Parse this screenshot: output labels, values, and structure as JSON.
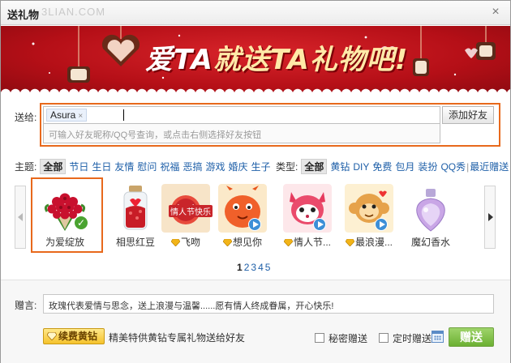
{
  "window": {
    "title": "送礼物",
    "watermark": "3LIAN.COM",
    "close_glyph": "×"
  },
  "banner": {
    "slogan_part1": "爱TA",
    "slogan_part2": "就送TA礼物吧!"
  },
  "recipient": {
    "label": "送给:",
    "tag_name": "Asura",
    "tag_remove": "×",
    "hint": "可输入好友昵称/QQ号查询，或点击右侧选择好友按钮",
    "add_button": "添加好友"
  },
  "theme_filter": {
    "label": "主题:",
    "selected": "全部",
    "items": [
      "节日",
      "生日",
      "友情",
      "慰问",
      "祝福",
      "恶搞",
      "游戏",
      "婚庆",
      "生子"
    ]
  },
  "type_filter": {
    "label": "类型:",
    "selected": "全部",
    "items": [
      "黄钻",
      "DIY",
      "免费",
      "包月",
      "装扮",
      "QQ秀"
    ],
    "separator": "|",
    "extra": "最近赠送"
  },
  "gifts": [
    {
      "name": "为爱绽放",
      "selected": true,
      "vip": false,
      "play": false
    },
    {
      "name": "相思红豆",
      "selected": false,
      "vip": false,
      "play": false
    },
    {
      "name": "飞吻",
      "selected": false,
      "vip": true,
      "play": false
    },
    {
      "name": "想见你",
      "selected": false,
      "vip": true,
      "play": true
    },
    {
      "name": "情人节...",
      "selected": false,
      "vip": true,
      "play": true
    },
    {
      "name": "最浪漫...",
      "selected": false,
      "vip": true,
      "play": true
    },
    {
      "name": "魔幻香水",
      "selected": false,
      "vip": false,
      "play": false
    }
  ],
  "pic_labels": {
    "valentine": "情人节快乐"
  },
  "pagination": {
    "current": "1",
    "pages": [
      "2",
      "3",
      "4",
      "5"
    ]
  },
  "message": {
    "label": "赠言:",
    "text": "玫瑰代表爱情与思念，送上浪漫与温馨......愿有情人终成眷属，开心快乐!"
  },
  "footer": {
    "renew_button": "续费黄钻",
    "renew_text": "精美特供黄钻专属礼物送给好友",
    "secret_label": "秘密赠送",
    "timed_label": "定时赠送",
    "send_button": "赠送"
  },
  "colors": {
    "accent_orange": "#e8691c",
    "banner_red": "#b50f17",
    "link_blue": "#1e5fa8",
    "send_green": "#6bb032"
  }
}
